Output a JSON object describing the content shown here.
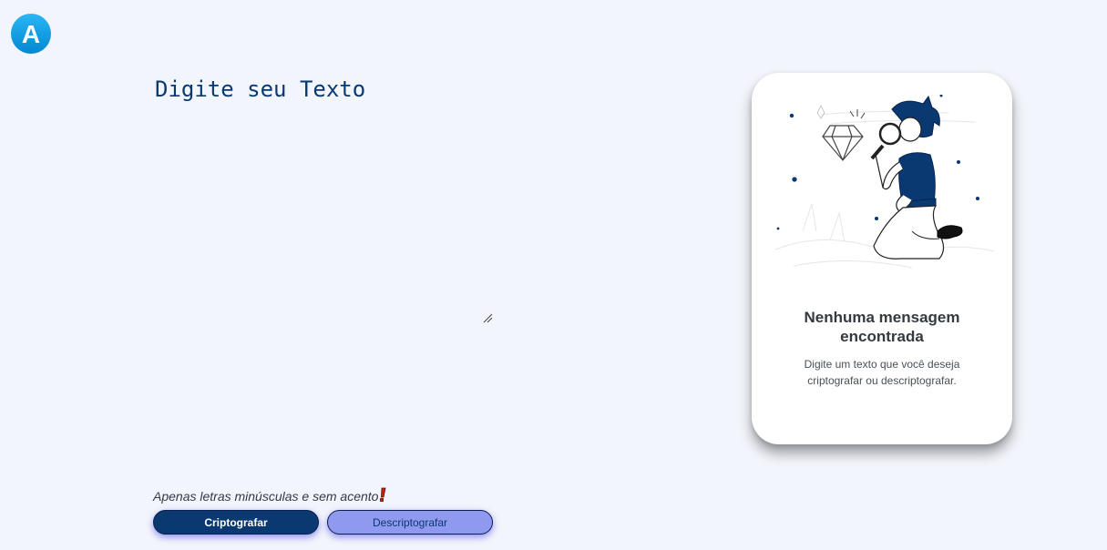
{
  "logo": {
    "letter": "A",
    "icon": "logo-a-icon"
  },
  "editor": {
    "placeholder": "Digite seu Texto",
    "value": ""
  },
  "hint": {
    "text": "Apenas letras minúsculas e sem acento",
    "icon": "exclamation-icon"
  },
  "buttons": {
    "encrypt_label": "Criptografar",
    "decrypt_label": "Descriptografar"
  },
  "output_card": {
    "title_line1": "Nenhuma mensagem",
    "title_line2": "encontrada",
    "subtitle_line1": "Digite um texto que você deseja",
    "subtitle_line2": "criptografar ou descriptografar.",
    "illustration": "person-with-magnifying-glass-illustration"
  },
  "colors": {
    "background": "#f3f5fc",
    "primary": "#0a3871",
    "secondary": "#8f99ef",
    "logo_gradient_top": "#29b6f6",
    "logo_gradient_bottom": "#0288d1"
  }
}
